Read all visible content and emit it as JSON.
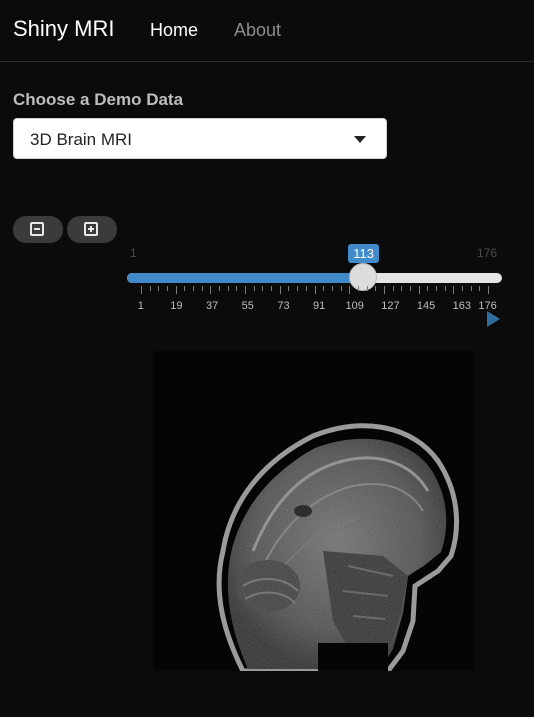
{
  "navbar": {
    "brand": "Shiny MRI",
    "items": [
      {
        "label": "Home",
        "active": true
      },
      {
        "label": "About",
        "active": false
      }
    ]
  },
  "selector": {
    "label": "Choose a Demo Data",
    "value": "3D Brain MRI"
  },
  "zoom": {
    "out_icon": "minus-square-icon",
    "in_icon": "plus-square-icon"
  },
  "slider": {
    "min": 1,
    "max": 176,
    "value": 113,
    "min_label": "1",
    "max_label": "176",
    "value_label": "113",
    "tick_labels": [
      "1",
      "19",
      "37",
      "55",
      "73",
      "91",
      "109",
      "127",
      "145",
      "163",
      "176"
    ],
    "accent_color": "#428bca",
    "play_icon": "play-icon"
  },
  "image": {
    "description_icon": "mri-sagittal-slice"
  }
}
